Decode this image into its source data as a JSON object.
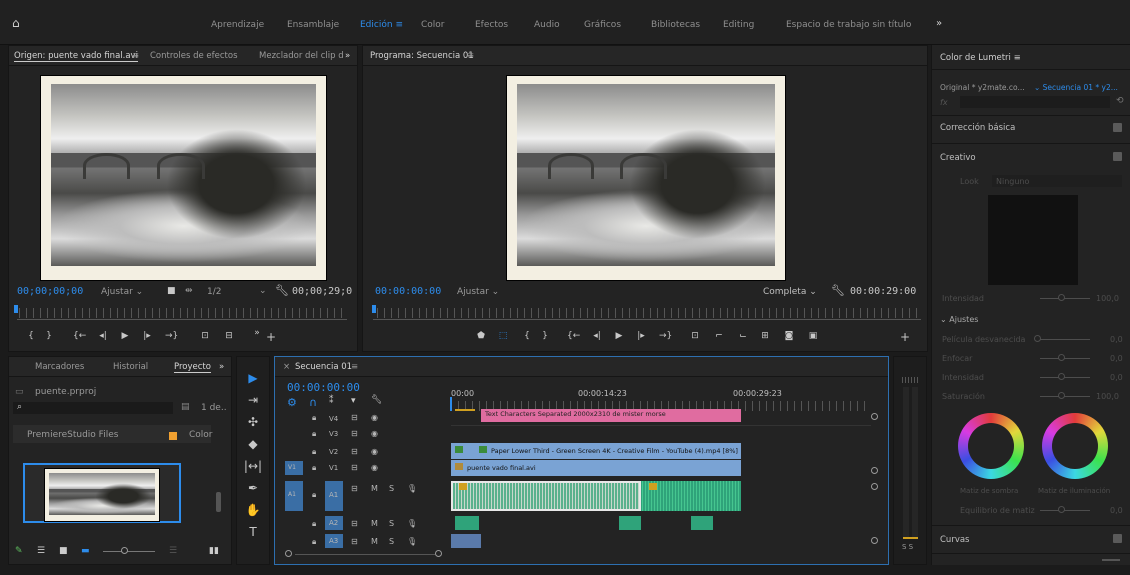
{
  "workspaces": [
    "Aprendizaje",
    "Ensamblaje",
    "Edición",
    "Color",
    "Efectos",
    "Audio",
    "Gráficos",
    "Bibliotecas",
    "Editing",
    "Espacio de trabajo sin título"
  ],
  "active_workspace": "Edición",
  "source": {
    "tabs": [
      "Origen: puente vado final.avi",
      "Controles de efectos",
      "Mezclador del clip d"
    ],
    "timecode_left": "00;00;00;00",
    "fit": "Ajustar",
    "resolution": "1/2",
    "timecode_right": "00;00;29;0"
  },
  "program": {
    "tab": "Programa: Secuencia 01",
    "timecode_left": "00:00:00:00",
    "fit": "Ajustar",
    "quality": "Completa",
    "timecode_right": "00:00:29:00"
  },
  "project": {
    "tabs": [
      "Marcadores",
      "Historial",
      "Proyecto"
    ],
    "file": "puente.prproj",
    "count": "1 de..",
    "item": "PremiereStudio Files",
    "col": "Color"
  },
  "timeline": {
    "tab": "Secuencia 01",
    "timecode": "00:00:00:00",
    "ruler": [
      "00:00",
      "00:00:14:23",
      "00:00:29:23"
    ],
    "tracks": [
      "V4",
      "V3",
      "V2",
      "V1",
      "A1",
      "A2",
      "A3"
    ],
    "clips": {
      "v4": "Text Characters Separated 2000x2310 de mister morse",
      "v2": "Paper Lower Third - Green Screen 4K - Creative Film - YouTube (4).mp4 [8%]",
      "v1": "puente vado final.avi"
    }
  },
  "lumetri": {
    "title": "Color de Lumetri",
    "source": "Original * y2mate.co...",
    "seq": "Secuencia 01 * y2...",
    "fx": "fx",
    "sections": [
      "Corrección básica",
      "Creativo",
      "Curvas"
    ],
    "look_label": "Look",
    "look_value": "Ninguno",
    "intensity": "Intensidad",
    "intensity_val": "100,0",
    "adjust": "Ajustes",
    "params": [
      {
        "label": "Película desvanecida",
        "val": "0,0"
      },
      {
        "label": "Enfocar",
        "val": "0,0"
      },
      {
        "label": "Intensidad",
        "val": "0,0"
      },
      {
        "label": "Saturación",
        "val": "100,0"
      }
    ],
    "wheel_left": "Matiz de sombra",
    "wheel_right": "Matiz de iluminación",
    "balance": "Equilibrio de matiz",
    "balance_val": "0,0"
  },
  "audio_meter": {
    "label": "S S"
  },
  "icons": [
    "home-icon",
    "wrench-icon",
    "play-icon",
    "camera-icon",
    "plus-icon",
    "chevron-right-icon"
  ]
}
